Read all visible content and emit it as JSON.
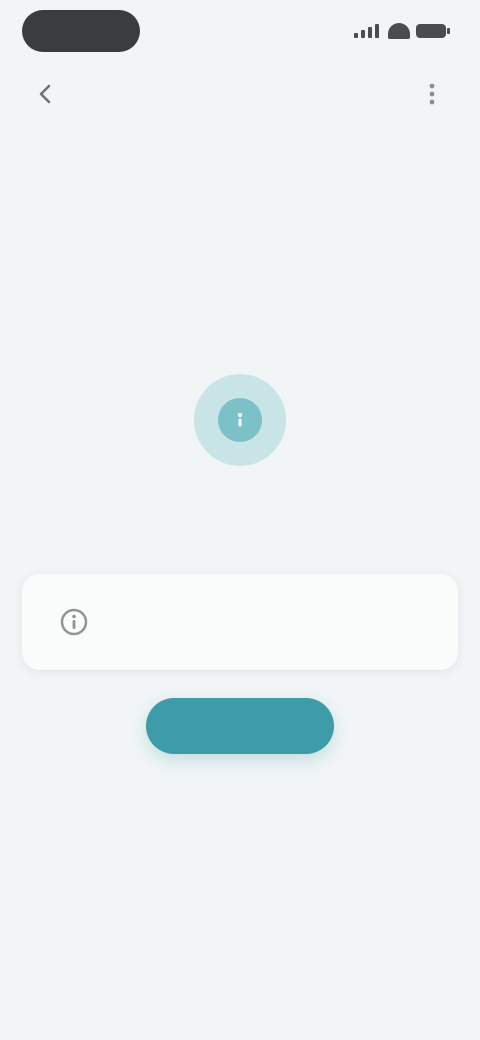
{
  "status_bar": {
    "time": ""
  },
  "header": {
    "title": "",
    "back_icon": "back-arrow-icon",
    "more_icon": "more-vertical-icon"
  },
  "main": {
    "hero_icon": "info-icon",
    "headline": "",
    "card": {
      "icon": "info-icon",
      "title": "",
      "text": ""
    },
    "primary_button_label": ""
  },
  "colors": {
    "background": "#f1f5f6",
    "accent": "#3e9ca8",
    "accent_light": "#c8e4e7",
    "card": "#fafcfc"
  }
}
